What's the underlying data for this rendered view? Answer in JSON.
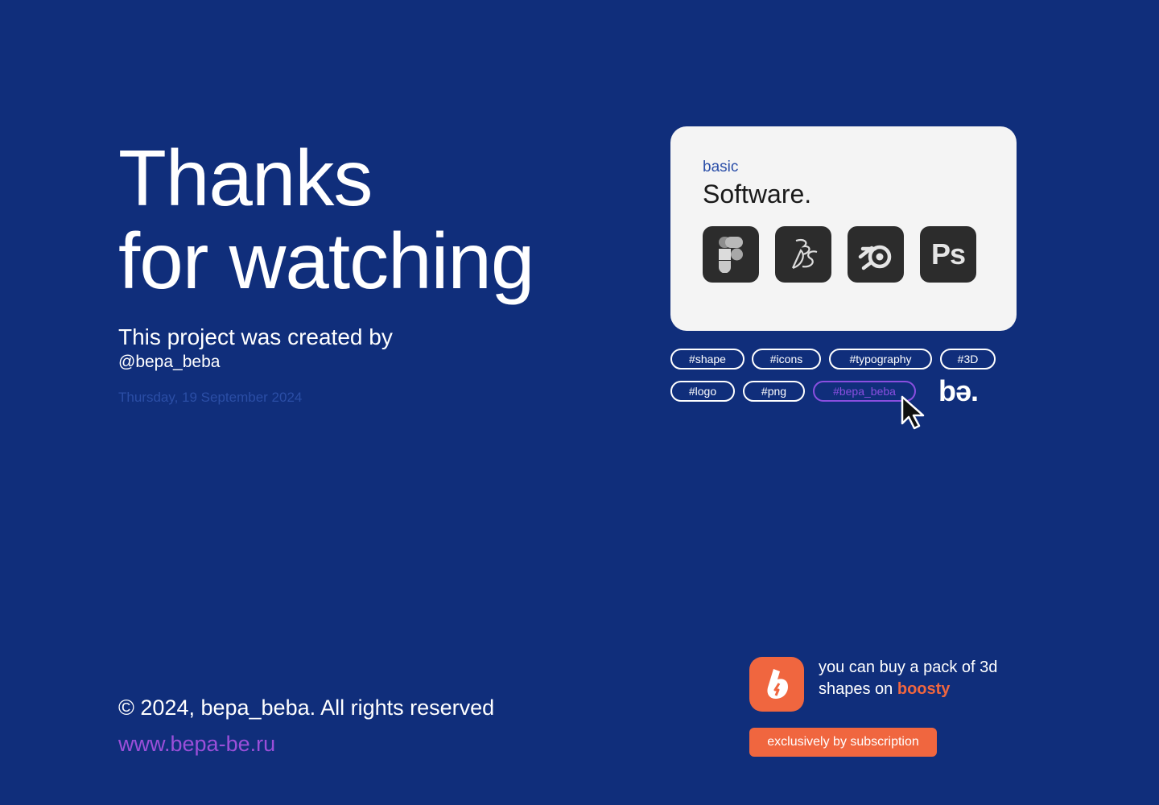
{
  "hero": {
    "title_line1": "Thanks",
    "title_line2": "for watching",
    "created_by": "This project was created by",
    "handle": "@bepa_beba",
    "date": "Thursday, 19 September 2024"
  },
  "footer": {
    "copyright": "© 2024, bepa_beba. All rights reserved",
    "website": "www.bepa-be.ru"
  },
  "software_card": {
    "label": "basic",
    "title": "Software.",
    "tools": [
      {
        "name": "Figma",
        "icon": "figma-icon"
      },
      {
        "name": "3DS",
        "icon": "3ds-icon"
      },
      {
        "name": "Blender",
        "icon": "blender-icon"
      },
      {
        "name": "Photoshop",
        "icon": "photoshop-icon",
        "glyph": "Ps"
      }
    ]
  },
  "tags": [
    "#shape",
    "#icons",
    "#typography",
    "#3D",
    "#logo",
    "#png",
    "#bepa_beba"
  ],
  "active_tag": "#bepa_beba",
  "brand_logo": "bə.",
  "promo": {
    "line1": "you can buy a pack of 3d",
    "line2_prefix": "shapes on ",
    "brand": "boosty",
    "button": "exclusively by subscription",
    "icon": "boosty-icon"
  },
  "colors": {
    "background": "#102e7b",
    "card": "#f4f4f4",
    "accent_orange": "#f0663f",
    "accent_purple": "#8a4fe0",
    "date_text": "#2b4ea6"
  }
}
